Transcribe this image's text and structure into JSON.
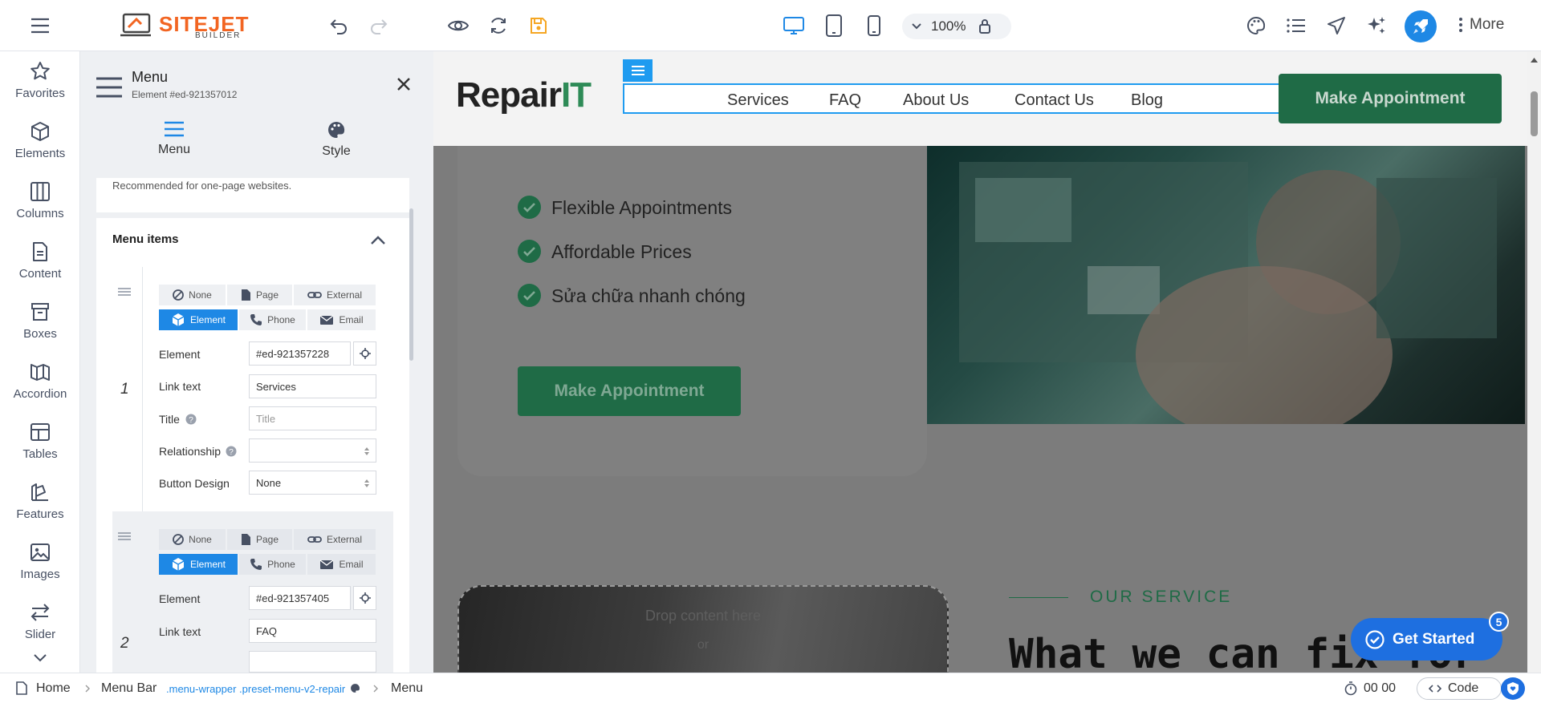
{
  "brand": {
    "name": "SITEJET",
    "sub": "BUILDER",
    "accent": "#f26522"
  },
  "toolbar": {
    "zoom": "100%",
    "more_label": "More",
    "primary_color": "#1e88e5",
    "save_color": "#f5a623"
  },
  "sidebar": {
    "items": [
      {
        "label": "Favorites",
        "icon": "star-icon"
      },
      {
        "label": "Elements",
        "icon": "cube-icon"
      },
      {
        "label": "Columns",
        "icon": "columns-icon"
      },
      {
        "label": "Content",
        "icon": "document-icon"
      },
      {
        "label": "Boxes",
        "icon": "box-icon"
      },
      {
        "label": "Accordion",
        "icon": "accordion-icon"
      },
      {
        "label": "Tables",
        "icon": "table-icon"
      },
      {
        "label": "Features",
        "icon": "features-icon"
      },
      {
        "label": "Images",
        "icon": "image-icon"
      },
      {
        "label": "Slider",
        "icon": "slider-icon"
      }
    ]
  },
  "panel": {
    "title": "Menu",
    "subtitle": "Element #ed-921357012",
    "tabs": [
      {
        "label": "Menu"
      },
      {
        "label": "Style"
      }
    ],
    "recommended_text": "Recommended for one-page websites.",
    "section_title": "Menu items",
    "link_types": [
      "None",
      "Page",
      "External",
      "Element",
      "Phone",
      "Email"
    ],
    "field_labels": {
      "element": "Element",
      "link_text": "Link text",
      "title": "Title",
      "relationship": "Relationship",
      "button_design": "Button Design"
    },
    "items": [
      {
        "number": "1",
        "element": "#ed-921357228",
        "link_text": "Services",
        "title_placeholder": "Title",
        "relationship": "",
        "button_design": "None"
      },
      {
        "number": "2",
        "element": "#ed-921357405",
        "link_text": "FAQ"
      }
    ]
  },
  "site": {
    "logo_a": "Repair",
    "logo_b": "IT",
    "logo_color": "#2e8b57",
    "nav": [
      "Services",
      "FAQ",
      "About Us",
      "Contact Us",
      "Blog"
    ],
    "header_cta": "Make Appointment",
    "checklist": [
      "Flexible Appointments",
      "Affordable Prices",
      "Sửa chữa nhanh chóng"
    ],
    "hero_cta": "Make Appointment",
    "drop_text": "Drop content here",
    "drop_or": "or",
    "section_label": "OUR SERVICE",
    "section_heading": "What we can fix for"
  },
  "get_started": {
    "label": "Get Started",
    "badge": "5"
  },
  "breadcrumb": {
    "items": [
      "Home",
      "Menu Bar",
      ".menu-wrapper .preset-menu-v2-repair",
      "Menu"
    ],
    "time": "00 00",
    "code_label": "Code"
  }
}
